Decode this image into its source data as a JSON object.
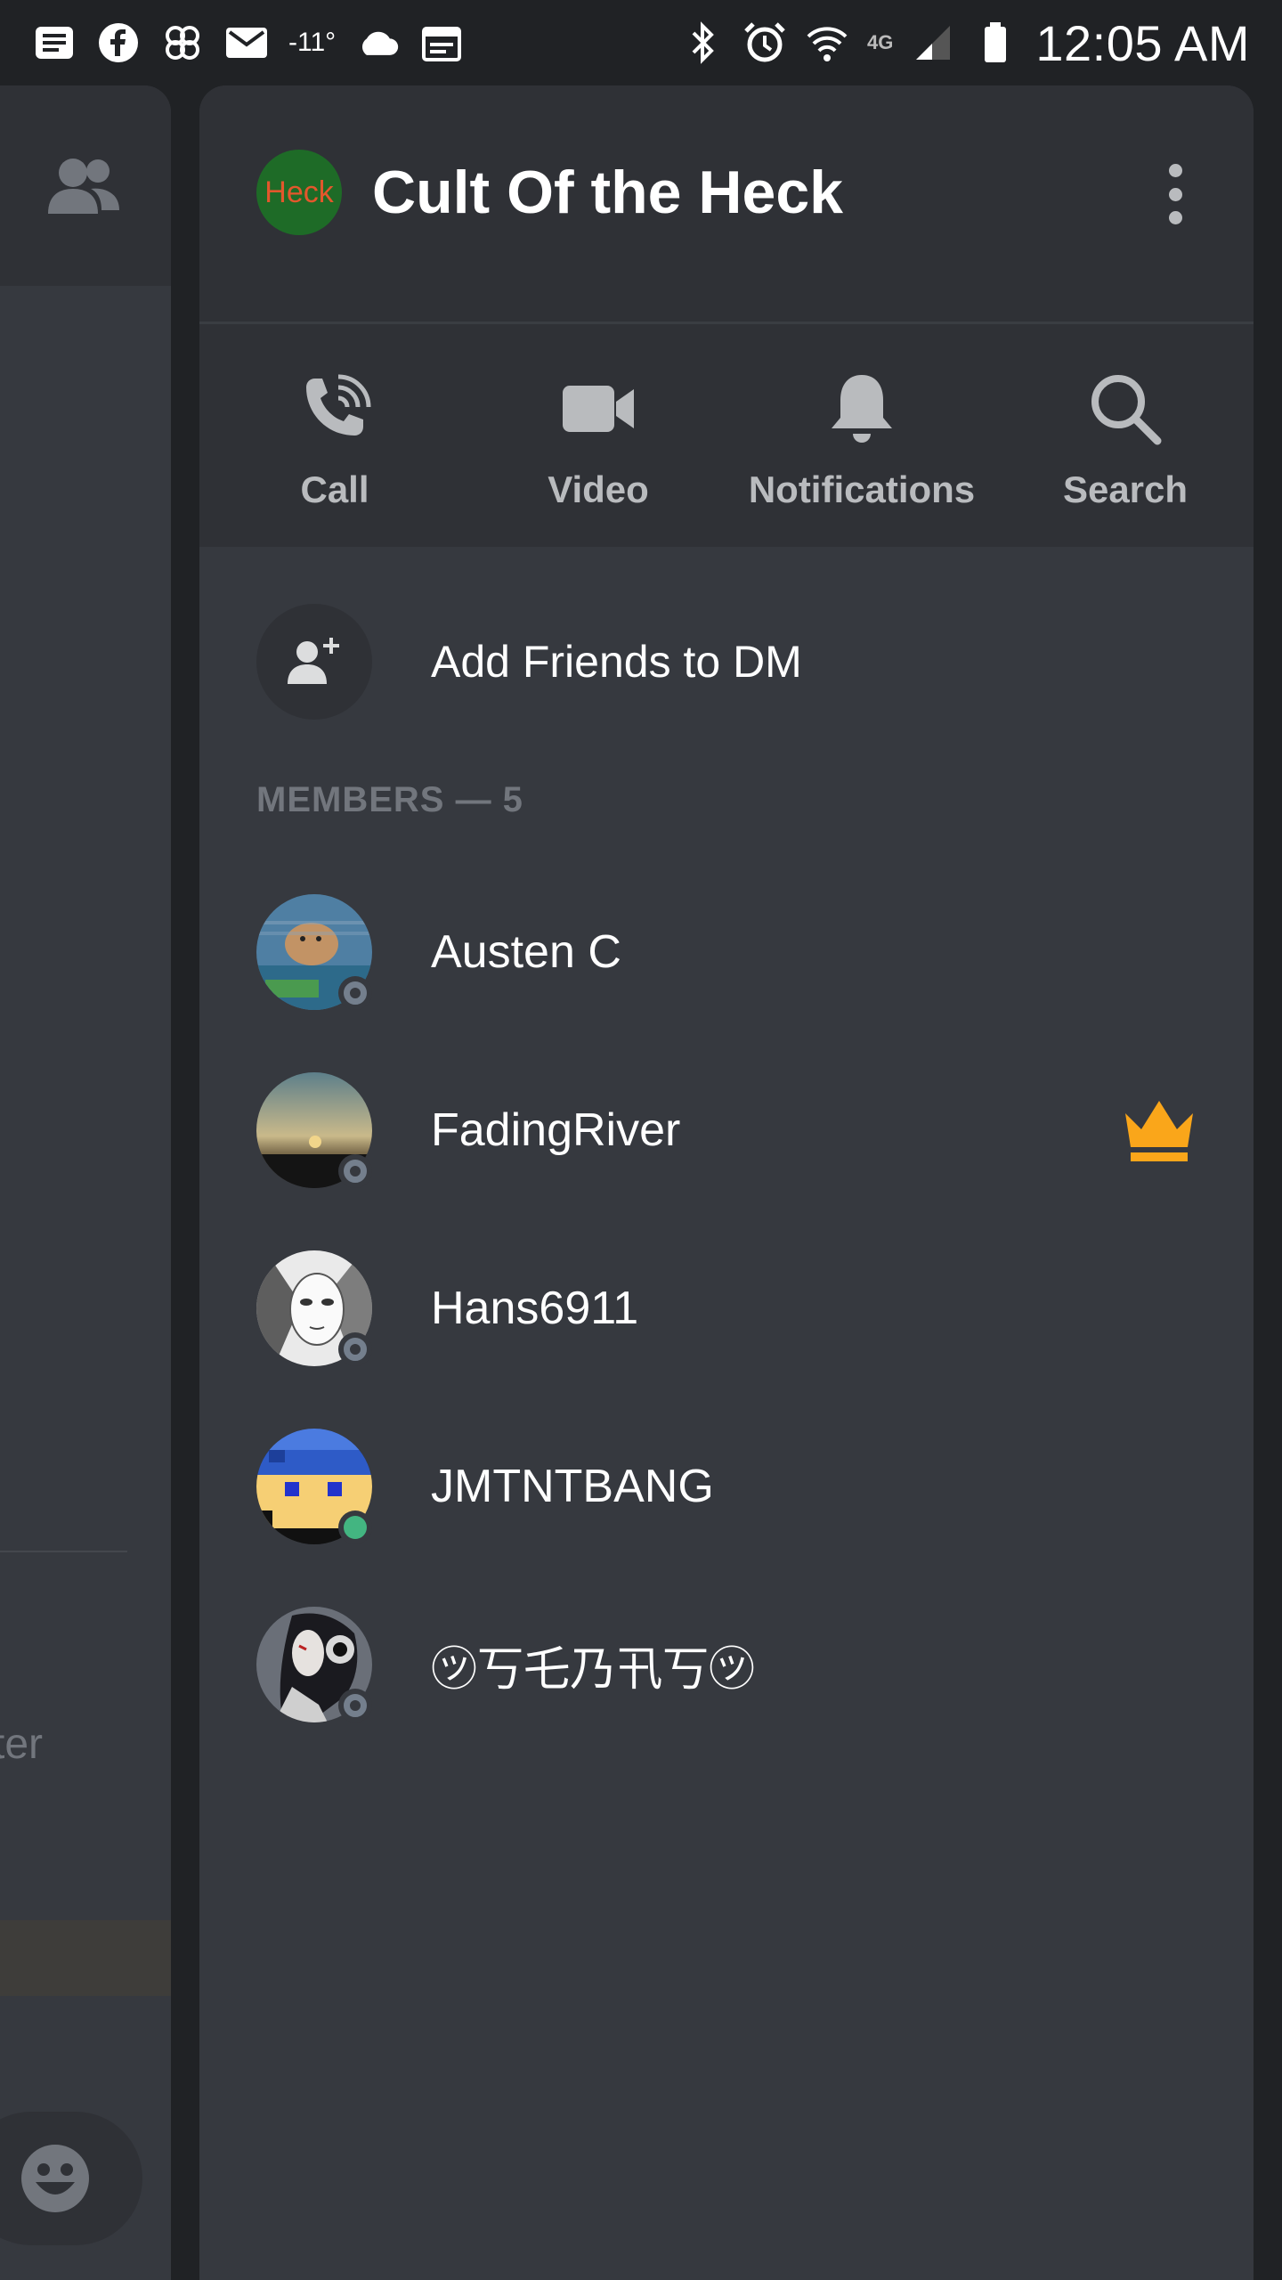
{
  "status_bar": {
    "temperature": "-11°",
    "network": "4G",
    "time": "12:05 AM"
  },
  "background_panel": {
    "partial_text": "ter"
  },
  "channel": {
    "avatar_text": "Heck",
    "title": "Cult Of the Heck"
  },
  "actions": [
    {
      "label": "Call",
      "icon": "phone-icon"
    },
    {
      "label": "Video",
      "icon": "video-camera-icon"
    },
    {
      "label": "Notifications",
      "icon": "bell-icon"
    },
    {
      "label": "Search",
      "icon": "search-icon"
    }
  ],
  "add_friends": {
    "label": "Add Friends to DM"
  },
  "members": {
    "header": "MEMBERS — 5",
    "list": [
      {
        "name": "Austen C",
        "status": "offline",
        "owner": false
      },
      {
        "name": "FadingRiver",
        "status": "offline",
        "owner": true
      },
      {
        "name": "Hans6911",
        "status": "offline",
        "owner": false
      },
      {
        "name": "JMTNTBANG",
        "status": "online",
        "owner": false
      },
      {
        "name": "㋡丂乇乃卂丂㋡",
        "status": "offline",
        "owner": false
      }
    ]
  },
  "colors": {
    "background": "#36393f",
    "header": "#2f3136",
    "crown": "#faa61a",
    "online": "#43b581",
    "offline": "#747f8d"
  }
}
